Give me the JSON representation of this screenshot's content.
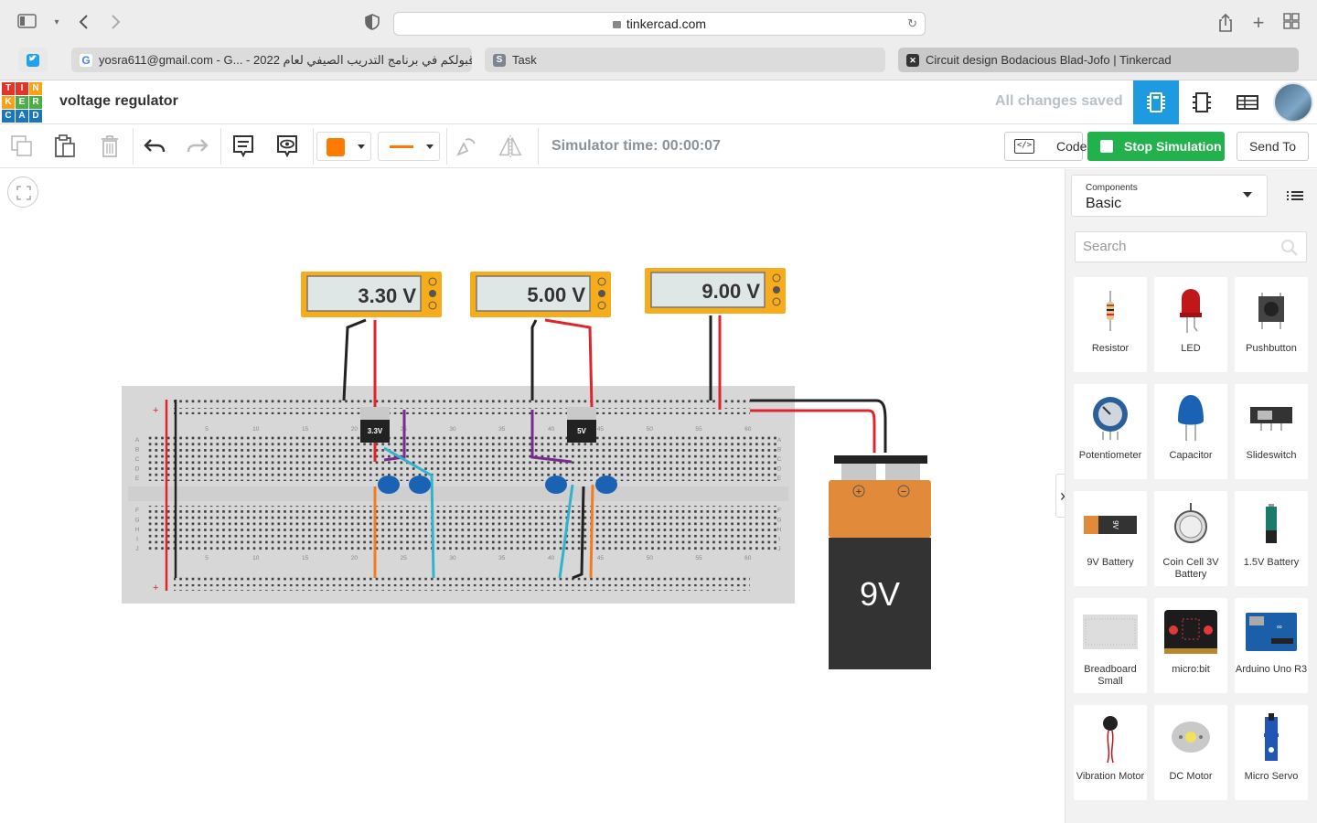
{
  "browser": {
    "url": "tinkercad.com",
    "tabs": [
      {
        "label": "yosra611@gmail.com - G... - 2022 تم قبولكم في برنامج التدريب الصيفي لعام",
        "favicon": "google-icon"
      },
      {
        "label": "Task",
        "favicon": "s-icon"
      },
      {
        "label": "Circuit design Bodacious Blad-Jofo | Tinkercad",
        "favicon": "tinkercad-icon"
      }
    ]
  },
  "header": {
    "logo_letters": [
      "T",
      "I",
      "N",
      "K",
      "E",
      "R",
      "C",
      "A",
      "D"
    ],
    "title": "voltage regulator",
    "saved_status": "All changes saved"
  },
  "toolbar": {
    "sim_time": "Simulator time: 00:00:07",
    "code_label": "Code",
    "stop_label": "Stop Simulation",
    "send_label": "Send To",
    "fill_color": "#ff7a00"
  },
  "circuit": {
    "multimeters": [
      {
        "reading": "3.30 V"
      },
      {
        "reading": "5.00 V"
      },
      {
        "reading": "9.00 V"
      }
    ],
    "regulators": [
      {
        "label": "3.3V"
      },
      {
        "label": "5V"
      }
    ],
    "battery_label": "9V",
    "battery_plus": "+",
    "battery_minus": "−",
    "column_numbers": [
      "5",
      "10",
      "15",
      "20",
      "25",
      "30",
      "35",
      "40",
      "45",
      "50",
      "55",
      "60"
    ],
    "row_letters_top": [
      "A",
      "B",
      "C",
      "D",
      "E"
    ],
    "row_letters_bottom": [
      "F",
      "G",
      "H",
      "I",
      "J"
    ]
  },
  "panel": {
    "components_label": "Components",
    "components_value": "Basic",
    "search_placeholder": "Search",
    "items": [
      {
        "name": "Resistor",
        "icon": "resistor-icon"
      },
      {
        "name": "LED",
        "icon": "led-icon"
      },
      {
        "name": "Pushbutton",
        "icon": "pushbutton-icon"
      },
      {
        "name": "Potentiometer",
        "icon": "potentiometer-icon"
      },
      {
        "name": "Capacitor",
        "icon": "capacitor-icon"
      },
      {
        "name": "Slideswitch",
        "icon": "slideswitch-icon"
      },
      {
        "name": "9V Battery",
        "icon": "battery-9v-icon"
      },
      {
        "name": "Coin Cell 3V Battery",
        "icon": "coin-cell-icon"
      },
      {
        "name": "1.5V Battery",
        "icon": "battery-1-5v-icon"
      },
      {
        "name": "Breadboard Small",
        "icon": "breadboard-icon"
      },
      {
        "name": "micro:bit",
        "icon": "microbit-icon"
      },
      {
        "name": "Arduino Uno R3",
        "icon": "arduino-icon"
      },
      {
        "name": "Vibration Motor",
        "icon": "vibration-motor-icon"
      },
      {
        "name": "DC Motor",
        "icon": "dc-motor-icon"
      },
      {
        "name": "Micro Servo",
        "icon": "micro-servo-icon"
      }
    ]
  }
}
